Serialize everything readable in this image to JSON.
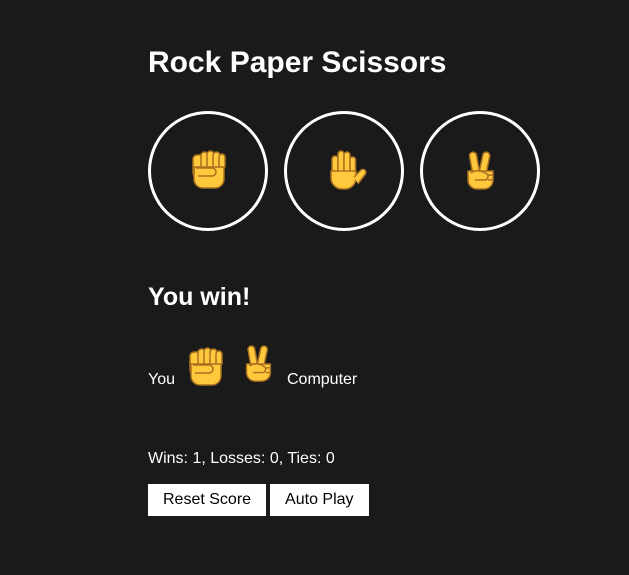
{
  "page": {
    "title": "Rock Paper Scissors"
  },
  "moves": [
    {
      "id": "rock",
      "icon": "raised-fist-emoji"
    },
    {
      "id": "paper",
      "icon": "raised-hand-emoji"
    },
    {
      "id": "scissors",
      "icon": "victory-hand-emoji"
    }
  ],
  "result": {
    "text": "You win!",
    "you_label": "You",
    "you_pick_icon": "raised-fist-emoji",
    "computer_pick_icon": "victory-hand-emoji",
    "computer_label": "Computer"
  },
  "score": {
    "text": "Wins: 1, Losses: 0, Ties: 0"
  },
  "controls": {
    "reset_label": "Reset Score",
    "autoplay_label": "Auto Play"
  },
  "colors": {
    "background": "#1a1a1a",
    "text": "#ffffff",
    "emoji_yellow": "#FFC83D",
    "emoji_outline": "#A7711F",
    "button_background": "#ffffff",
    "button_text": "#000000"
  }
}
